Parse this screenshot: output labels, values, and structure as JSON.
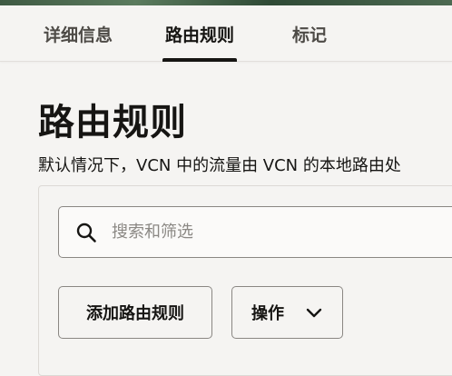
{
  "tabs": [
    {
      "label": "详细信息",
      "active": false
    },
    {
      "label": "路由规则",
      "active": true
    },
    {
      "label": "标记",
      "active": false
    }
  ],
  "page": {
    "title": "路由规则",
    "description": "默认情况下，VCN 中的流量由 VCN 的本地路由处"
  },
  "search": {
    "placeholder": "搜索和筛选",
    "icon": "search-icon"
  },
  "toolbar": {
    "add_label": "添加路由规则",
    "actions_label": "操作",
    "actions_icon": "chevron-down-icon"
  }
}
